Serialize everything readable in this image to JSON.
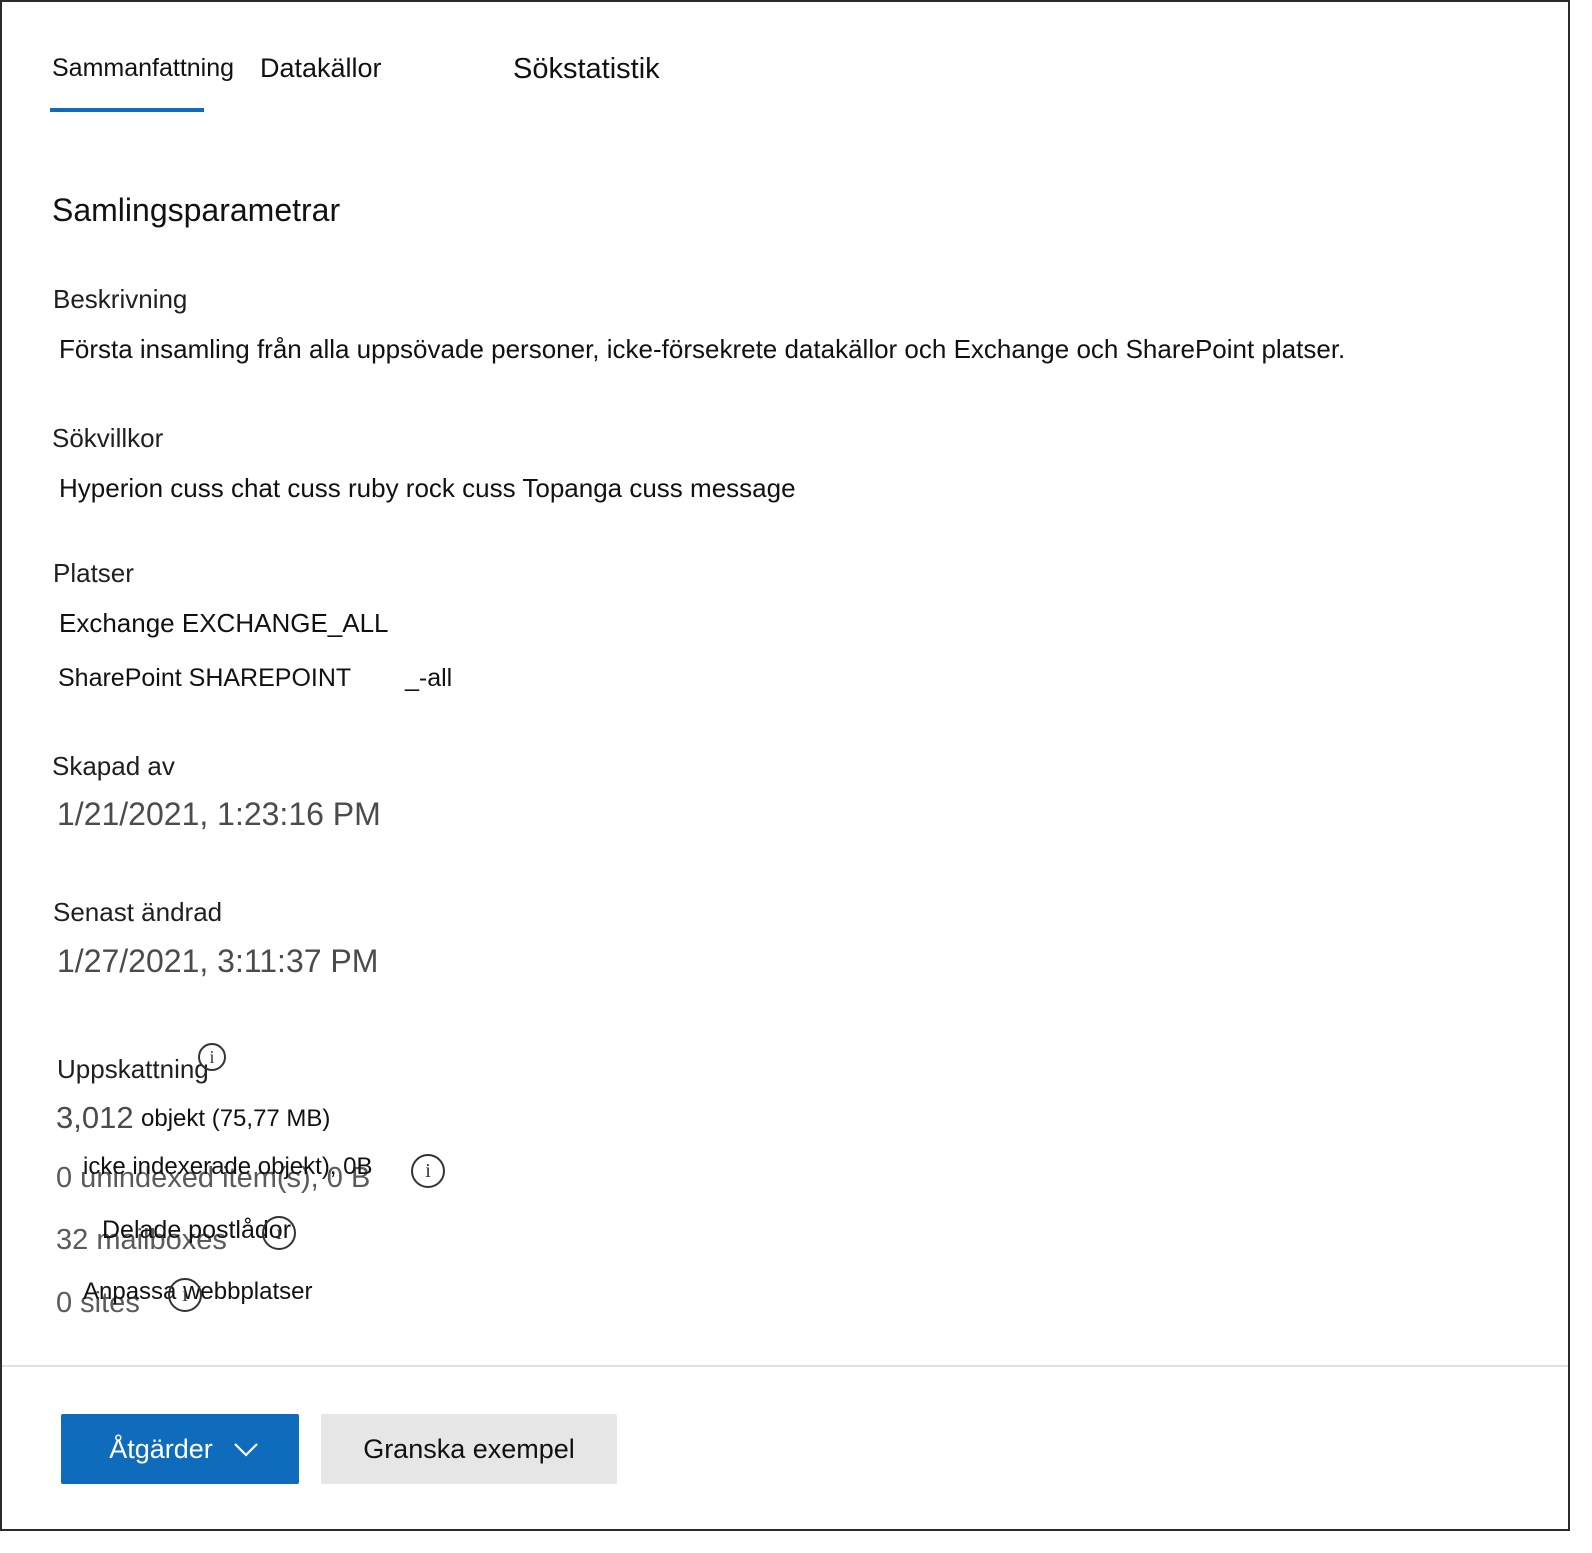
{
  "tabs": [
    {
      "label": "Sammanfattning",
      "active": true
    },
    {
      "label": "Datakällor",
      "active": false
    },
    {
      "label": "Sökstatistik",
      "active": false
    }
  ],
  "section_title": "Samlingsparametrar",
  "description": {
    "label": "Beskrivning",
    "value": "Första insamling från alla uppsövade personer, icke-försekrete datakällor och Exchange och SharePoint platser."
  },
  "conditions": {
    "label": "Sökvillkor",
    "value": "Hyperion cuss chat cuss ruby rock cuss Topanga cuss message"
  },
  "locations": {
    "label": "Platser",
    "exchange": "Exchange EXCHANGE_ALL",
    "sharepoint": "SharePoint SHAREPOINT",
    "sharepoint_suffix": "_-all"
  },
  "created_by": {
    "label": "Skapad av",
    "value": "1/21/2021, 1:23:16 PM"
  },
  "modified": {
    "label": "Senast ändrad",
    "value": "1/27/2021, 3:11:37 PM"
  },
  "estimate": {
    "label": "Uppskattning",
    "items_count": "3,012",
    "items_text": "objekt (75,77 MB)",
    "unindexed_ghost": "0 unindexed item(s), 0 B",
    "unindexed_text": "icke indexerade objekt), 0B",
    "mailboxes_ghost": "32 mailboxes",
    "mailboxes_text": "Delade postlådor",
    "sites_ghost": "0 sites",
    "sites_text": "Anpassa webbplatser"
  },
  "info_glyph": "i",
  "actions": {
    "primary_label": "Åtgärder",
    "secondary_label": "Granska exempel"
  },
  "colors": {
    "accent": "#0f6cbd",
    "secondary_button": "#e6e6e6",
    "divider": "#e1e1e1"
  }
}
